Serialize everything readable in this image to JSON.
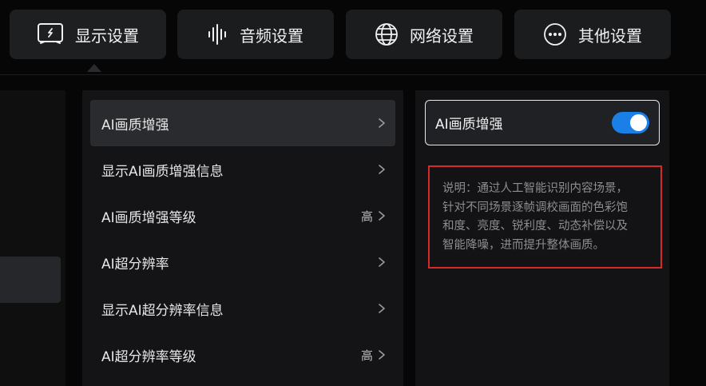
{
  "tabs": [
    {
      "label": "显示设置",
      "icon": "display-settings-icon",
      "active": true
    },
    {
      "label": "音频设置",
      "icon": "audio-wave-icon",
      "active": false
    },
    {
      "label": "网络设置",
      "icon": "globe-icon",
      "active": false
    },
    {
      "label": "其他设置",
      "icon": "more-dots-icon",
      "active": false
    }
  ],
  "menu": {
    "items": [
      {
        "label": "AI画质增强",
        "value": "",
        "selected": true
      },
      {
        "label": "显示AI画质增强信息",
        "value": "",
        "selected": false
      },
      {
        "label": "AI画质增强等级",
        "value": "高",
        "selected": false
      },
      {
        "label": "AI超分辨率",
        "value": "",
        "selected": false
      },
      {
        "label": "显示AI超分辨率信息",
        "value": "",
        "selected": false
      },
      {
        "label": "AI超分辨率等级",
        "value": "高",
        "selected": false
      }
    ]
  },
  "detail": {
    "toggle_label": "AI画质增强",
    "toggle_on": true,
    "description_lines": [
      "说明：通过人工智能识别内容场景，",
      "针对不同场景逐帧调校画面的色彩饱",
      "和度、亮度、锐利度、动态补偿以及",
      "智能降噪，进而提升整体画质。"
    ]
  },
  "colors": {
    "accent": "#1a7fe6",
    "highlight_border": "#d42a2a",
    "background": "#060606"
  }
}
